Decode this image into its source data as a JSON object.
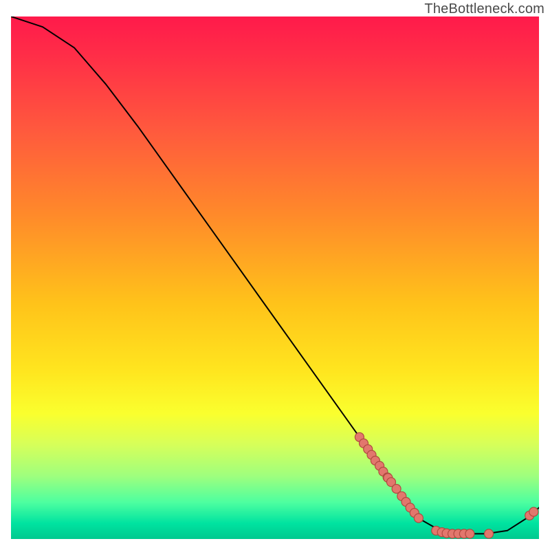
{
  "watermark": "TheBottleneck.com",
  "colors": {
    "point_fill": "#e2776d",
    "point_stroke": "#b04a3f",
    "line": "#000000"
  },
  "chart_data": {
    "type": "line",
    "title": "",
    "xlabel": "",
    "ylabel": "",
    "xlim": [
      0,
      100
    ],
    "ylim": [
      0,
      100
    ],
    "curve": [
      {
        "x": 0,
        "y": 100
      },
      {
        "x": 6,
        "y": 98
      },
      {
        "x": 12,
        "y": 94
      },
      {
        "x": 18,
        "y": 87
      },
      {
        "x": 24,
        "y": 79
      },
      {
        "x": 30,
        "y": 70.5
      },
      {
        "x": 36,
        "y": 62
      },
      {
        "x": 42,
        "y": 53.5
      },
      {
        "x": 48,
        "y": 45
      },
      {
        "x": 54,
        "y": 36.5
      },
      {
        "x": 60,
        "y": 28
      },
      {
        "x": 66,
        "y": 19.5
      },
      {
        "x": 72,
        "y": 11
      },
      {
        "x": 78,
        "y": 3.5
      },
      {
        "x": 82,
        "y": 1.2
      },
      {
        "x": 86,
        "y": 1.0
      },
      {
        "x": 90,
        "y": 1.0
      },
      {
        "x": 94,
        "y": 1.6
      },
      {
        "x": 98,
        "y": 4.2
      },
      {
        "x": 100,
        "y": 6.0
      }
    ],
    "points": [
      {
        "x": 66.0,
        "y": 19.5
      },
      {
        "x": 66.8,
        "y": 18.3
      },
      {
        "x": 67.6,
        "y": 17.2
      },
      {
        "x": 68.3,
        "y": 16.1
      },
      {
        "x": 69.0,
        "y": 15.0
      },
      {
        "x": 69.8,
        "y": 14.0
      },
      {
        "x": 70.5,
        "y": 12.9
      },
      {
        "x": 71.3,
        "y": 11.8
      },
      {
        "x": 71.4,
        "y": 11.7
      },
      {
        "x": 72.0,
        "y": 10.9
      },
      {
        "x": 73.0,
        "y": 9.6
      },
      {
        "x": 74.0,
        "y": 8.2
      },
      {
        "x": 74.8,
        "y": 7.1
      },
      {
        "x": 75.6,
        "y": 6.0
      },
      {
        "x": 76.4,
        "y": 5.0
      },
      {
        "x": 77.2,
        "y": 4.0
      },
      {
        "x": 80.5,
        "y": 1.6
      },
      {
        "x": 81.6,
        "y": 1.3
      },
      {
        "x": 82.5,
        "y": 1.1
      },
      {
        "x": 83.6,
        "y": 1.0
      },
      {
        "x": 84.7,
        "y": 1.0
      },
      {
        "x": 85.8,
        "y": 1.0
      },
      {
        "x": 86.9,
        "y": 1.0
      },
      {
        "x": 90.5,
        "y": 1.0
      },
      {
        "x": 98.2,
        "y": 4.5
      },
      {
        "x": 99.0,
        "y": 5.2
      }
    ],
    "point_radius": 6.5
  }
}
